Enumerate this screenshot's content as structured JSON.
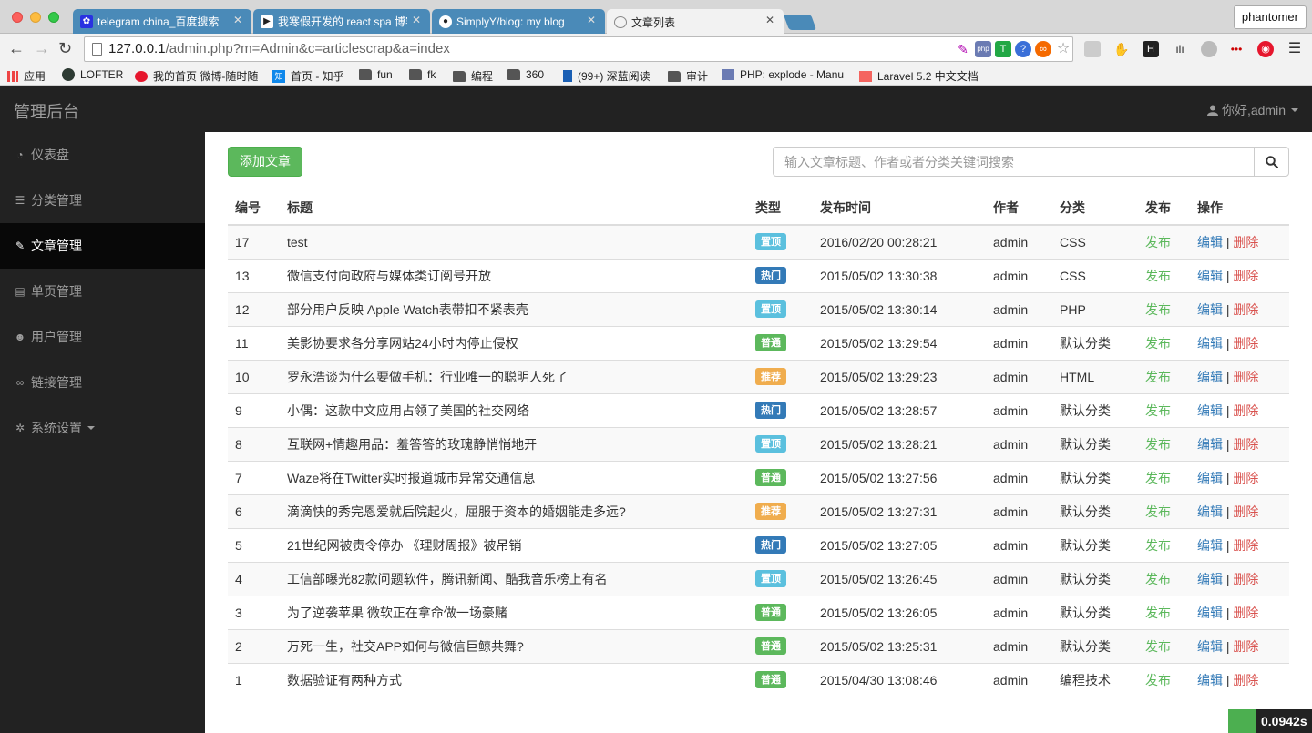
{
  "browser": {
    "tabs": [
      {
        "label": "telegram china_百度搜索",
        "icon": "baidu-paw-icon",
        "color": "#2932e1"
      },
      {
        "label": "我寒假开发的 react spa 博客",
        "icon": "cnblogs-icon",
        "color": "#222222"
      },
      {
        "label": "SimplyY/blog: my blog",
        "icon": "github-icon",
        "color": "#222222"
      },
      {
        "label": "文章列表",
        "icon": "page-icon",
        "color": "#888888"
      }
    ],
    "profile": "phantomer",
    "url_host": "127.0.0.1",
    "url_path": "/admin.php?m=Admin&c=articlescrap&a=index",
    "bookmarks": [
      {
        "label": "应用",
        "icon": "apps-grid-icon"
      },
      {
        "label": "LOFTER",
        "icon": "lofter-icon"
      },
      {
        "label": "我的首页 微博-随时随",
        "icon": "weibo-icon"
      },
      {
        "label": "首页 - 知乎",
        "icon": "zhihu-icon"
      },
      {
        "label": "fun",
        "icon": "folder-icon"
      },
      {
        "label": "fk",
        "icon": "folder-icon"
      },
      {
        "label": "编程",
        "icon": "folder-icon"
      },
      {
        "label": "360",
        "icon": "folder-icon"
      },
      {
        "label": "(99+) 深蓝阅读",
        "icon": "bookmark-icon"
      },
      {
        "label": "审计",
        "icon": "folder-icon"
      },
      {
        "label": "PHP: explode - Manu",
        "icon": "php-icon"
      },
      {
        "label": "Laravel 5.2 中文文档",
        "icon": "laravel-icon"
      }
    ]
  },
  "header": {
    "brand": "管理后台",
    "user_greeting": "你好,admin"
  },
  "sidebar": {
    "items": [
      {
        "label": "仪表盘",
        "icon": "dashboard-icon"
      },
      {
        "label": "分类管理",
        "icon": "list-icon"
      },
      {
        "label": "文章管理",
        "icon": "edit-icon",
        "active": true
      },
      {
        "label": "单页管理",
        "icon": "file-icon"
      },
      {
        "label": "用户管理",
        "icon": "users-icon"
      },
      {
        "label": "链接管理",
        "icon": "link-icon"
      },
      {
        "label": "系统设置",
        "icon": "cog-icon",
        "dropdown": true
      }
    ]
  },
  "toolbar": {
    "add_label": "添加文章",
    "search_placeholder": "输入文章标题、作者或者分类关键词搜索"
  },
  "table": {
    "headers": [
      "编号",
      "标题",
      "类型",
      "发布时间",
      "作者",
      "分类",
      "发布",
      "操作"
    ],
    "rows": [
      {
        "id": "17",
        "title": "test",
        "type": "置顶",
        "time": "2016/02/20 00:28:21",
        "author": "admin",
        "category": "CSS",
        "publish": "发布"
      },
      {
        "id": "13",
        "title": "微信支付向政府与媒体类订阅号开放",
        "type": "热门",
        "time": "2015/05/02 13:30:38",
        "author": "admin",
        "category": "CSS",
        "publish": "发布"
      },
      {
        "id": "12",
        "title": "部分用户反映 Apple Watch表带扣不紧表壳",
        "type": "置顶",
        "time": "2015/05/02 13:30:14",
        "author": "admin",
        "category": "PHP",
        "publish": "发布"
      },
      {
        "id": "11",
        "title": "美影协要求各分享网站24小时内停止侵权",
        "type": "普通",
        "time": "2015/05/02 13:29:54",
        "author": "admin",
        "category": "默认分类",
        "publish": "发布"
      },
      {
        "id": "10",
        "title": "罗永浩谈为什么要做手机：行业唯一的聪明人死了",
        "type": "推荐",
        "time": "2015/05/02 13:29:23",
        "author": "admin",
        "category": "HTML",
        "publish": "发布"
      },
      {
        "id": "9",
        "title": "小偶：这款中文应用占领了美国的社交网络",
        "type": "热门",
        "time": "2015/05/02 13:28:57",
        "author": "admin",
        "category": "默认分类",
        "publish": "发布"
      },
      {
        "id": "8",
        "title": "互联网+情趣用品：羞答答的玫瑰静悄悄地开",
        "type": "置顶",
        "time": "2015/05/02 13:28:21",
        "author": "admin",
        "category": "默认分类",
        "publish": "发布"
      },
      {
        "id": "7",
        "title": "Waze将在Twitter实时报道城市异常交通信息",
        "type": "普通",
        "time": "2015/05/02 13:27:56",
        "author": "admin",
        "category": "默认分类",
        "publish": "发布"
      },
      {
        "id": "6",
        "title": "滴滴快的秀完恩爱就后院起火，屈服于资本的婚姻能走多远?",
        "type": "推荐",
        "time": "2015/05/02 13:27:31",
        "author": "admin",
        "category": "默认分类",
        "publish": "发布"
      },
      {
        "id": "5",
        "title": "21世纪网被责令停办 《理财周报》被吊销",
        "type": "热门",
        "time": "2015/05/02 13:27:05",
        "author": "admin",
        "category": "默认分类",
        "publish": "发布"
      },
      {
        "id": "4",
        "title": "工信部曝光82款问题软件，腾讯新闻、酷我音乐榜上有名",
        "type": "置顶",
        "time": "2015/05/02 13:26:45",
        "author": "admin",
        "category": "默认分类",
        "publish": "发布"
      },
      {
        "id": "3",
        "title": "为了逆袭苹果 微软正在拿命做一场豪赌",
        "type": "普通",
        "time": "2015/05/02 13:26:05",
        "author": "admin",
        "category": "默认分类",
        "publish": "发布"
      },
      {
        "id": "2",
        "title": "万死一生，社交APP如何与微信巨鲸共舞?",
        "type": "普通",
        "time": "2015/05/02 13:25:31",
        "author": "admin",
        "category": "默认分类",
        "publish": "发布"
      },
      {
        "id": "1",
        "title": "数据验证有两种方式",
        "type": "普通",
        "time": "2015/04/30 13:08:46",
        "author": "admin",
        "category": "编程技术",
        "publish": "发布"
      }
    ],
    "edit_label": "编辑",
    "delete_label": "删除",
    "action_separator": "|"
  },
  "type_colors": {
    "置顶": "#5bc0de",
    "热门": "#337ab7",
    "普通": "#5cb85c",
    "推荐": "#f0ad4e"
  },
  "debug_timer": "0.0942s"
}
